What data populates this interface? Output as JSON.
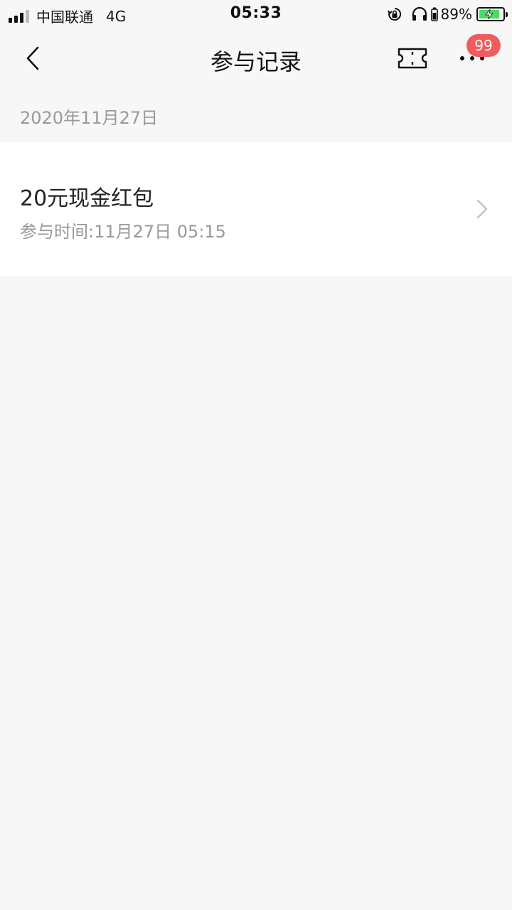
{
  "status_bar": {
    "carrier": "中国联通",
    "network": "4G",
    "time": "05:33",
    "battery": "89%",
    "icons": [
      "signal-icon",
      "rotation-lock-icon",
      "headphones-icon",
      "battery-charging-icon"
    ]
  },
  "nav": {
    "title": "参与记录",
    "badge": "99",
    "icons": [
      "back-chevron-icon",
      "ticket-icon",
      "more-dots-icon"
    ]
  },
  "records": {
    "date": "2020年11月27日",
    "items": [
      {
        "title": "20元现金红包",
        "time": "参与时间:11月27日 05:15"
      }
    ]
  },
  "colors": {
    "background": "#f7f7f7",
    "card": "#ffffff",
    "badge": "#f25b5b",
    "battery_fill": "#4cd964",
    "secondary_text": "#999999"
  }
}
